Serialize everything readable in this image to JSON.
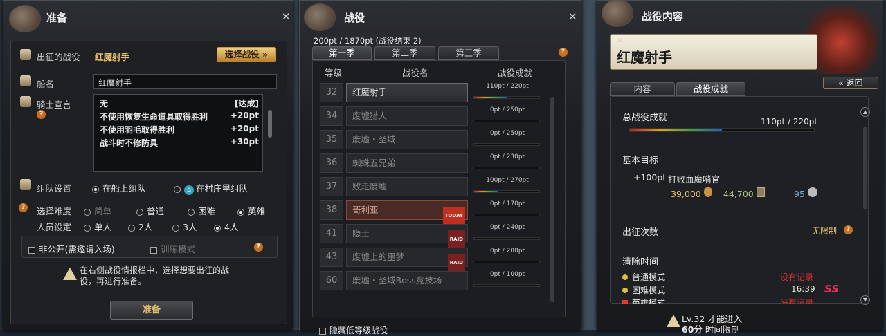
{
  "left": {
    "title": "准备",
    "close": "✕",
    "campaign_label": "出征的战役",
    "campaign_value": "红魔射手",
    "select_button": "选择战役",
    "ship_label": "船名",
    "ship_value": "红魔射手",
    "oath_label": "骑士宣言",
    "oaths": [
      {
        "text": "无",
        "pts": "[达成]"
      },
      {
        "text": "不使用恢复生命道具取得胜利",
        "pts": "+20pt"
      },
      {
        "text": "不使用羽毛取得胜利",
        "pts": "+20pt"
      },
      {
        "text": "战斗时不修防具",
        "pts": "+30pt"
      }
    ],
    "team_label": "组队设置",
    "team_opt1": "在船上组队",
    "team_opt2": "在村庄里组队",
    "diff_label": "选择难度",
    "diff": [
      "简单",
      "普通",
      "困难",
      "英雄"
    ],
    "people_label": "人员设定",
    "people": [
      "单人",
      "2人",
      "3人",
      "4人"
    ],
    "private_label": "非公开(需邀请入场)",
    "training_label": "训练模式",
    "notice": "在右侧战役情报栏中，选择想要出征的战役，再进行准备。",
    "ready_button": "准备"
  },
  "mid": {
    "title": "战役",
    "close": "✕",
    "points": "200pt / 1870pt (战役结束 2)",
    "tabs": [
      "第一季",
      "第二季",
      "第三季"
    ],
    "cols": [
      "等级",
      "战役名",
      "战役成就"
    ],
    "rows": [
      {
        "lvl": "32",
        "name": "红魔射手",
        "pts": "110pt / 220pt",
        "prog": 0.5,
        "badge": ""
      },
      {
        "lvl": "34",
        "name": "废墟猎人",
        "pts": "0pt / 250pt",
        "prog": 0,
        "badge": ""
      },
      {
        "lvl": "35",
        "name": "废墟・圣域",
        "pts": "0pt / 250pt",
        "prog": 0,
        "badge": ""
      },
      {
        "lvl": "36",
        "name": "蜘蛛五兄弟",
        "pts": "0pt / 230pt",
        "prog": 0,
        "badge": ""
      },
      {
        "lvl": "37",
        "name": "败走废墟",
        "pts": "100pt / 270pt",
        "prog": 0.37,
        "badge": ""
      },
      {
        "lvl": "38",
        "name": "哥利亚",
        "pts": "0pt / 170pt",
        "prog": 0,
        "badge": "TODAY"
      },
      {
        "lvl": "41",
        "name": "隐士",
        "pts": "0pt / 240pt",
        "prog": 0,
        "badge": "RAID"
      },
      {
        "lvl": "43",
        "name": "废墟上的噩梦",
        "pts": "0pt / 200pt",
        "prog": 0,
        "badge": "RAID"
      },
      {
        "lvl": "60",
        "name": "废墟・圣域Boss竞技场",
        "pts": "0pt / 100pt",
        "prog": 0,
        "badge": ""
      }
    ],
    "hide_low": "隐藏低等级战役"
  },
  "right": {
    "title": "战役内容",
    "close": "✕",
    "campaign": "红魔射手",
    "tabs": [
      "内容",
      "战役成就"
    ],
    "back": "返回",
    "total_label": "总战役成就",
    "total_pts": "110pt / 220pt",
    "total_prog": 0.5,
    "goal_label": "基本目标",
    "goal_pts": "+100pt",
    "goal_text": "打败血魔哨官",
    "reward_gold": "39,000",
    "reward_exp": "44,700",
    "reward_ap": "95",
    "times_label": "出征次数",
    "times_value": "无限制",
    "clear_label": "清除时间",
    "modes": [
      {
        "name": "普通模式",
        "value": "没有记录",
        "rank": ""
      },
      {
        "name": "困难模式",
        "value": "16:39",
        "rank": "SS"
      },
      {
        "name": "英雄模式",
        "value": "没有记录",
        "rank": ""
      }
    ],
    "req_level": "Lv.32 才能进入",
    "req_time": "60分",
    "req_time_label": "时间限制"
  }
}
